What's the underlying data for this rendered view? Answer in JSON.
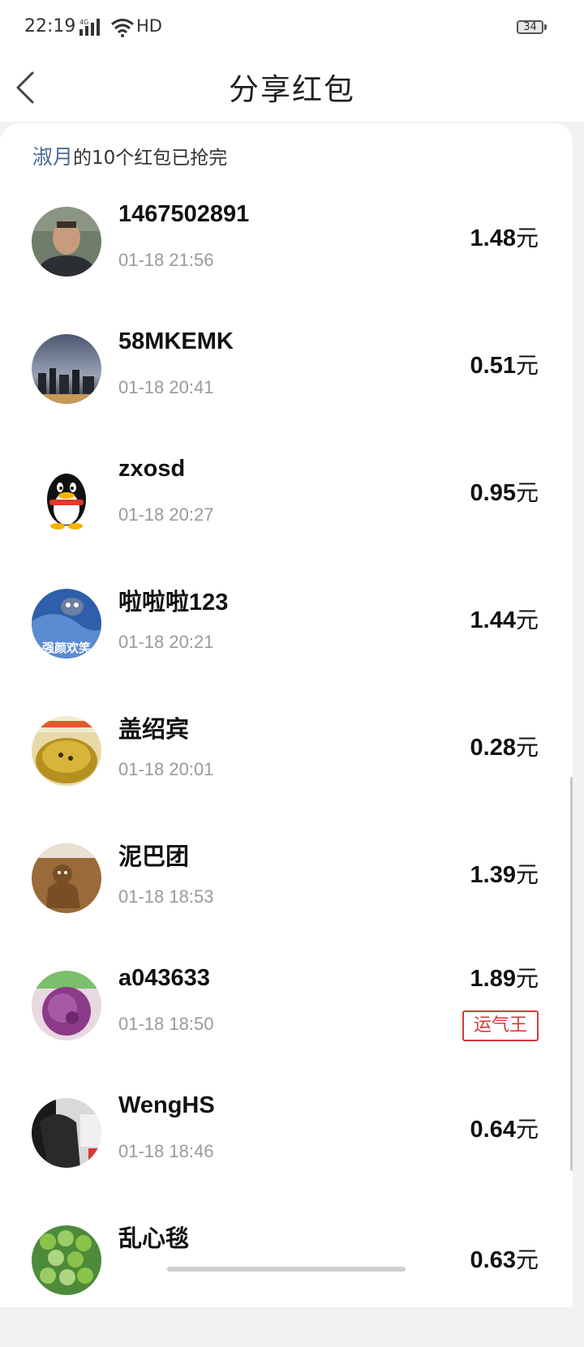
{
  "status_bar": {
    "time": "22:19",
    "network": "4G",
    "quality": "HD",
    "battery": "34"
  },
  "nav": {
    "title": "分享红包",
    "back_icon": "chevron-left-icon"
  },
  "summary": {
    "sender": "淑月",
    "text": "的10个红包已抢完"
  },
  "lucky_label": "运气王",
  "currency_unit": "元",
  "entries": [
    {
      "name": "1467502891",
      "time": "01-18 21:56",
      "amount": "1.48",
      "lucky": false
    },
    {
      "name": "58MKEMK",
      "time": "01-18 20:41",
      "amount": "0.51",
      "lucky": false
    },
    {
      "name": "zxosd",
      "time": "01-18 20:27",
      "amount": "0.95",
      "lucky": false
    },
    {
      "name": "啦啦啦123",
      "time": "01-18 20:21",
      "amount": "1.44",
      "lucky": false,
      "avatar_text": "强颜欢笑"
    },
    {
      "name": "盖绍宾",
      "time": "01-18 20:01",
      "amount": "0.28",
      "lucky": false
    },
    {
      "name": "泥巴团",
      "time": "01-18 18:53",
      "amount": "1.39",
      "lucky": false
    },
    {
      "name": "a043633",
      "time": "01-18 18:50",
      "amount": "1.89",
      "lucky": true
    },
    {
      "name": "WengHS",
      "time": "01-18 18:46",
      "amount": "0.64",
      "lucky": false
    },
    {
      "name": "乱心毯",
      "time": "",
      "amount": "0.63",
      "lucky": false
    }
  ]
}
